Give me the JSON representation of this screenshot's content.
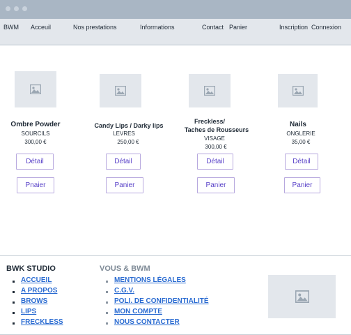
{
  "nav": {
    "brand": "BWM",
    "items": [
      "Acceuil",
      "Nos prestations",
      "Informations",
      "Contact",
      "Panier",
      "Inscription",
      "Connexion"
    ]
  },
  "products": [
    {
      "name": "Ombre Powder",
      "category": "SOURCILS",
      "price": "300,00 €",
      "detail": "Détail",
      "cart": "Pnaier"
    },
    {
      "name": "Candy Lips / Darky lips",
      "category": "LEVRES",
      "price": "250,00 €",
      "detail": "Détail",
      "cart": "Panier"
    },
    {
      "name_line1": "Freckless/",
      "name_line2": "Taches de Rousseurs",
      "category": "VISAGE",
      "price": "300,00 €",
      "detail": "Détail",
      "cart": "Panier"
    },
    {
      "name": "Nails",
      "category": "ONGLERIE",
      "price": "35,00 €",
      "detail": "Détail",
      "cart": "Panier"
    }
  ],
  "footer": {
    "col1": {
      "title": "BWK STUDIO",
      "links": [
        "ACCUEIL",
        "A PROPOS",
        "BROWS",
        "LIPS",
        "FRECKLESS"
      ]
    },
    "col2": {
      "title": "VOUS & BWM",
      "links": [
        "MENTIONS LÉGALES",
        "C.G.V.",
        "POLI. DE CONFIDENTIALITÉ",
        "MON COMPTE",
        "NOUS CONTACTER"
      ]
    }
  },
  "icons": {
    "image_placeholder": "image-icon"
  },
  "colors": {
    "titlebar": "#a9b6c4",
    "nav_bg": "#e3e7ec",
    "button_text": "#5a43c8",
    "link": "#2a6bd1"
  }
}
